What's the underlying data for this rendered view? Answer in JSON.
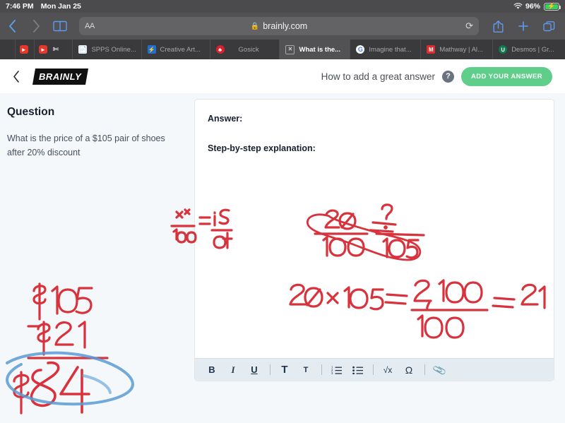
{
  "statusbar": {
    "time": "7:46 PM",
    "date": "Mon Jan 25",
    "battery_percent": "96%",
    "wifi_icon": "wifi-icon",
    "battery_icon": "battery-charging-icon"
  },
  "browser": {
    "back_icon": "chevron-left-icon",
    "forward_icon": "chevron-right-icon",
    "reader_icon": "book-icon",
    "text_size_label": "AA",
    "lock_icon": "lock-icon",
    "url": "brainly.com",
    "reload_icon": "reload-icon",
    "share_icon": "share-icon",
    "newtab_icon": "plus-icon",
    "tabs_icon": "tabs-overview-icon",
    "tabs": [
      {
        "title": "",
        "favicon": "youtube-icon",
        "active": false
      },
      {
        "title": "",
        "favicon": "youtube-icon",
        "active": false
      },
      {
        "title": "",
        "favicon": "scissors-icon",
        "active": false
      },
      {
        "title": "SPPS Online...",
        "favicon": "document-icon",
        "active": false
      },
      {
        "title": "Creative Art...",
        "favicon": "creative-icon",
        "active": false
      },
      {
        "title": "Gosick",
        "favicon": "gosick-icon",
        "active": false
      },
      {
        "title": "What is the...",
        "favicon": "close-icon",
        "active": true
      },
      {
        "title": "Imagine that...",
        "favicon": "google-icon",
        "active": false
      },
      {
        "title": "Mathway | Al...",
        "favicon": "mathway-icon",
        "active": false
      },
      {
        "title": "Desmos | Gr...",
        "favicon": "desmos-icon",
        "active": false
      }
    ]
  },
  "header": {
    "back_icon": "chevron-left-icon",
    "logo_text": "BRAINLY",
    "how_to_label": "How to add a great answer",
    "help_icon": "question-mark-icon",
    "add_answer_label": "ADD YOUR ANSWER",
    "accent_green": "#5ece8a"
  },
  "question": {
    "heading": "Question",
    "text": "What is the price of a $105 pair of shoes after 20% discount"
  },
  "editor": {
    "answer_label": "Answer:",
    "explanation_label": "Step-by-step explanation:",
    "toolbar": [
      {
        "name": "bold-button",
        "glyph": "B"
      },
      {
        "name": "italic-button",
        "glyph": "I"
      },
      {
        "name": "underline-button",
        "glyph": "U"
      },
      {
        "name": "heading-large-button",
        "glyph": "T"
      },
      {
        "name": "heading-small-button",
        "glyph": "T"
      },
      {
        "name": "ordered-list-button",
        "glyph": "list-ordered-icon"
      },
      {
        "name": "unordered-list-button",
        "glyph": "list-bullet-icon"
      },
      {
        "name": "math-button",
        "glyph": "√x"
      },
      {
        "name": "symbol-button",
        "glyph": "Ω"
      },
      {
        "name": "attachment-button",
        "glyph": "paperclip-icon"
      }
    ]
  },
  "annotations": {
    "ink_red": "#d8323c",
    "ink_blue": "#4a90d9",
    "proportion_percent": "%",
    "proportion_hundred": "100",
    "proportion_is": "is",
    "proportion_of": "of",
    "setup_numerator": "20",
    "setup_denominator": "100",
    "setup_unknown": "?",
    "setup_total": "105",
    "work_line": "20 × 105 =",
    "work_numerator": "2,100",
    "work_denominator": "100",
    "work_result": "21",
    "sub_top": "$105",
    "sub_minus": "−$21",
    "sub_answer": "$84"
  }
}
